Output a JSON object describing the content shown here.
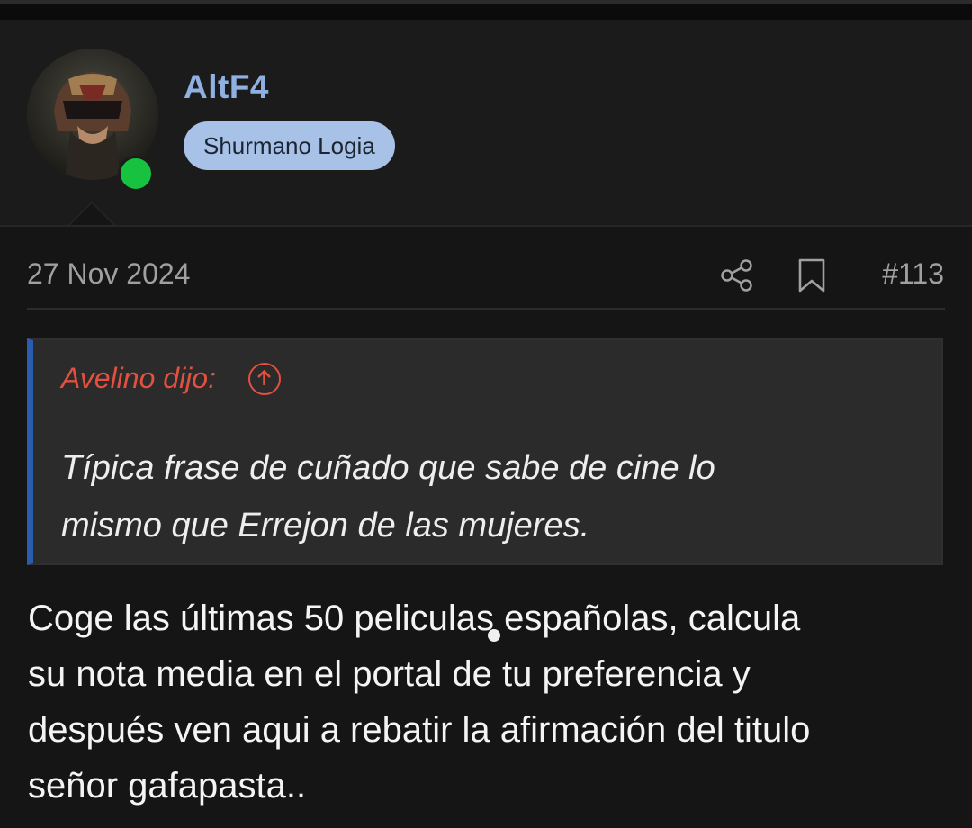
{
  "user": {
    "name": "AltF4",
    "role": "Shurmano Logia",
    "online": true
  },
  "post": {
    "date": "27 Nov 2024",
    "number": "#113",
    "quote": {
      "author": "Avelino dijo:",
      "lines": [
        "Típica frase de cuñado que sabe de cine lo",
        "mismo que Errejon de las mujeres."
      ]
    },
    "body_lines": [
      "Coge las últimas 50 peliculas españolas, calcula",
      "su nota media en el portal de tu preferencia y",
      "después ven aqui a rebatir la afirmación del titulo",
      "señor gafapasta.."
    ]
  },
  "icons": {
    "share": "share-icon",
    "bookmark": "bookmark-icon",
    "quote_jump": "arrow-up-circle-icon",
    "online": "online-status-icon"
  },
  "colors": {
    "username": "#8fb0e0",
    "badge_bg": "#a8c1e6",
    "quote_author": "#e2503f",
    "quote_bar": "#2a5db0",
    "online": "#16c23f"
  }
}
